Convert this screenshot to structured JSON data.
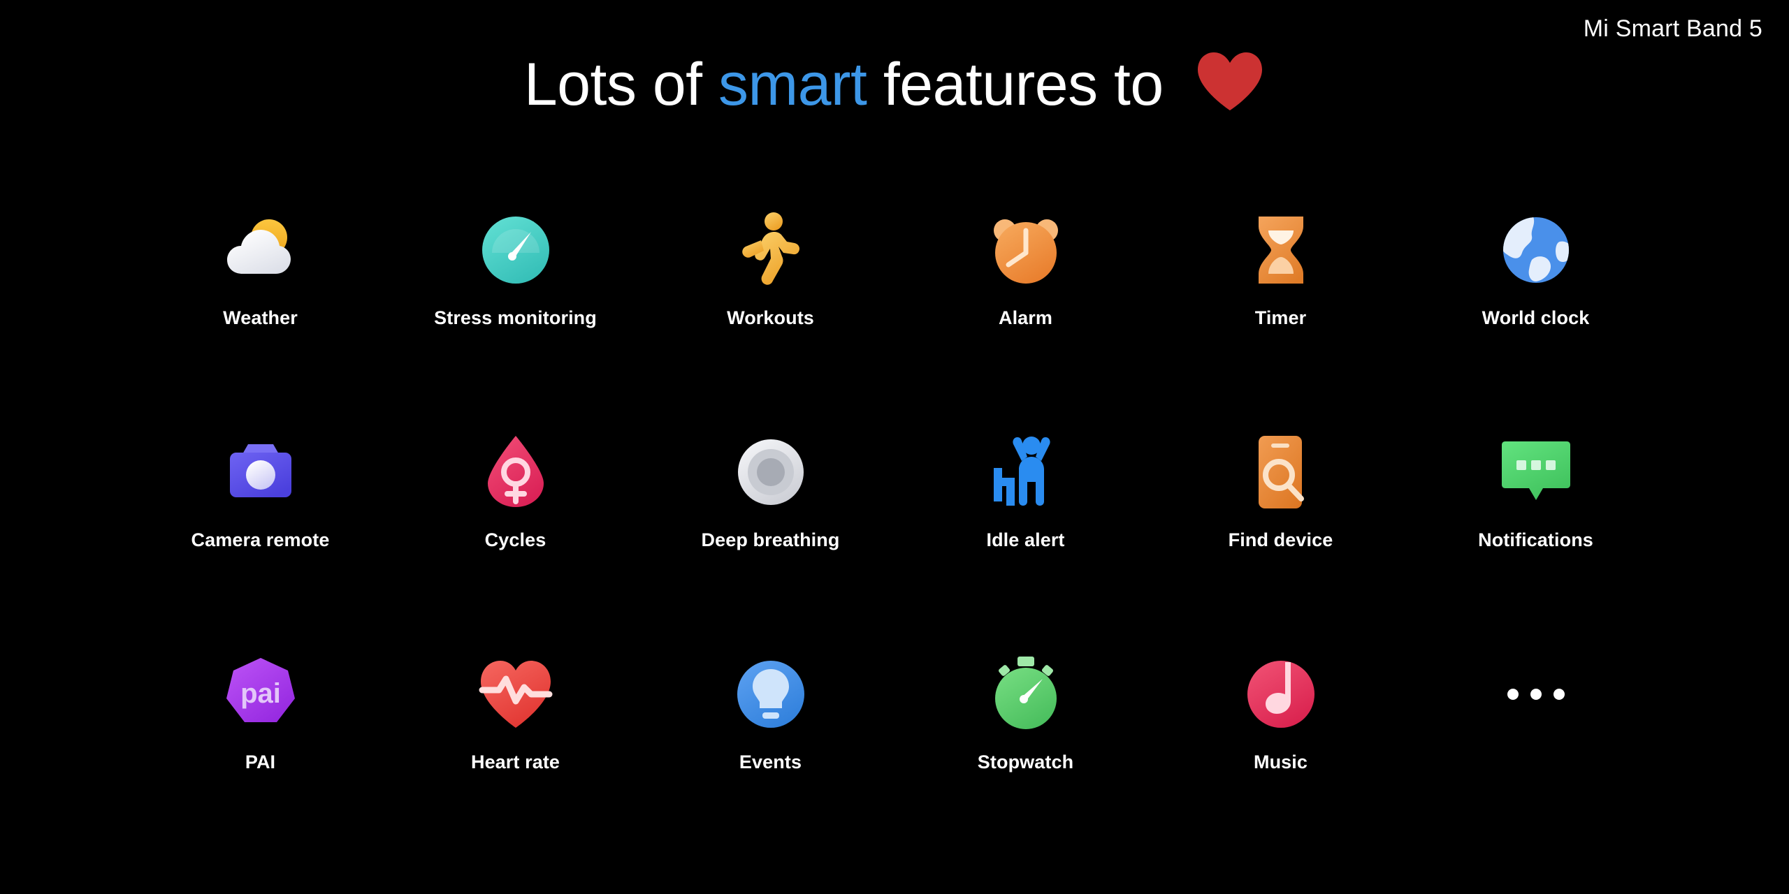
{
  "brand": "Mi Smart Band 5",
  "headline": {
    "part1": "Lots of ",
    "accent": "smart",
    "part2": " features to ",
    "heart_icon": "heart-icon",
    "heart_color": "#cc3232"
  },
  "colors": {
    "background": "#000000",
    "text": "#ffffff",
    "accent_blue": "#3d97e8",
    "weather_sun": "#f5b52e",
    "weather_cloud": "#eef1f6",
    "stress_teal": "#47cec5",
    "workouts_orange": "#f0a52f",
    "alarm_orange": "#ee8a36",
    "timer_orange": "#e88a34",
    "globe_blue": "#4a90ea",
    "camera_indigo": "#5b52e8",
    "cycles_pink": "#e8305f",
    "breathing_gray": "#d6d8dd",
    "idle_blue": "#2a8cf0",
    "find_orange": "#e8842f",
    "notifications_green": "#4fd06b",
    "pai_purple": "#a93ceb",
    "heartrate_red": "#ef4f4a",
    "events_blue": "#3d8ce8",
    "stopwatch_green": "#5fcc6e",
    "music_pink": "#e83b63"
  },
  "features": [
    {
      "label": "Weather",
      "icon": "weather-cloud-sun-icon"
    },
    {
      "label": "Stress monitoring",
      "icon": "stress-gauge-icon"
    },
    {
      "label": "Workouts",
      "icon": "running-person-icon"
    },
    {
      "label": "Alarm",
      "icon": "alarm-clock-icon"
    },
    {
      "label": "Timer",
      "icon": "hourglass-icon"
    },
    {
      "label": "World clock",
      "icon": "globe-icon"
    },
    {
      "label": "Camera remote",
      "icon": "camera-icon"
    },
    {
      "label": "Cycles",
      "icon": "droplet-venus-icon"
    },
    {
      "label": "Deep breathing",
      "icon": "concentric-circles-icon"
    },
    {
      "label": "Idle alert",
      "icon": "stretching-person-icon"
    },
    {
      "label": "Find device",
      "icon": "phone-magnifier-icon"
    },
    {
      "label": "Notifications",
      "icon": "speech-bubble-icon"
    },
    {
      "label": "PAI",
      "icon": "pai-heptagon-icon"
    },
    {
      "label": "Heart rate",
      "icon": "heart-pulse-icon"
    },
    {
      "label": "Events",
      "icon": "lightbulb-icon"
    },
    {
      "label": "Stopwatch",
      "icon": "stopwatch-icon"
    },
    {
      "label": "Music",
      "icon": "music-note-icon"
    },
    {
      "label": "",
      "icon": "more-dots-icon"
    }
  ]
}
